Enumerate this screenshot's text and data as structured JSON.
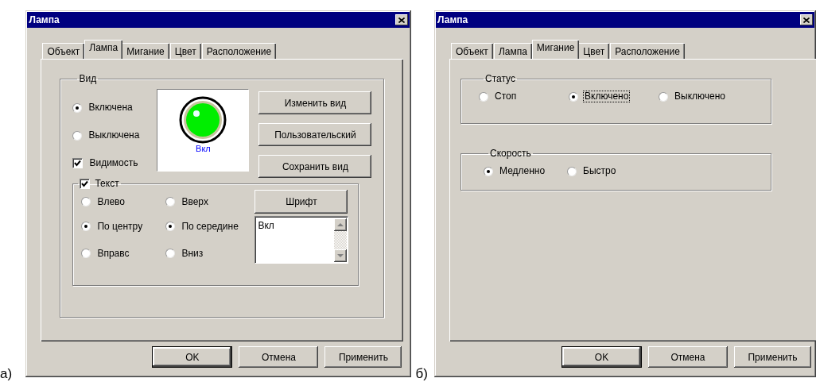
{
  "panels": [
    {
      "caption": "а)",
      "kind": "lamp",
      "window": {
        "title": "Лампа",
        "tabs": [
          {
            "label": "Объект",
            "selected": false
          },
          {
            "label": "Лампа",
            "selected": true
          },
          {
            "label": "Мигание",
            "selected": false
          },
          {
            "label": "Цвет",
            "selected": false
          },
          {
            "label": "Расположение",
            "selected": false
          }
        ],
        "view_group": {
          "label": "Вид",
          "radios": [
            {
              "label": "Включена",
              "selected": true
            },
            {
              "label": "Выключена",
              "selected": false
            }
          ],
          "visibility": {
            "label": "Видимость",
            "checked": true
          },
          "preview_text": "Вкл",
          "buttons": [
            "Изменить вид",
            "Пользовательский",
            "Сохранить вид"
          ]
        },
        "text_group": {
          "label": "Текст",
          "checked": true,
          "horizontal": [
            {
              "label": "Влево",
              "selected": false
            },
            {
              "label": "По центру",
              "selected": true
            },
            {
              "label": "Вправс",
              "selected": false
            }
          ],
          "vertical": [
            {
              "label": "Вверх",
              "selected": false
            },
            {
              "label": "По середине",
              "selected": true
            },
            {
              "label": "Вниз",
              "selected": false
            }
          ],
          "font_button": "Шрифт",
          "text_value": "Вкл"
        },
        "buttons": [
          {
            "label": "OK",
            "default": true
          },
          {
            "label": "Отмена",
            "default": false
          },
          {
            "label": "Применить",
            "default": false
          }
        ]
      }
    },
    {
      "caption": "б)",
      "kind": "blink",
      "window": {
        "title": "Лампа",
        "tabs": [
          {
            "label": "Объект",
            "selected": false
          },
          {
            "label": "Лампа",
            "selected": false
          },
          {
            "label": "Мигание",
            "selected": true
          },
          {
            "label": "Цвет",
            "selected": false
          },
          {
            "label": "Расположение",
            "selected": false
          }
        ],
        "groups": [
          {
            "label": "Статус",
            "options": [
              {
                "label": "Стоп",
                "selected": false,
                "focused": false
              },
              {
                "label": "Включено",
                "selected": true,
                "focused": true
              },
              {
                "label": "Выключено",
                "selected": false,
                "focused": false
              }
            ]
          },
          {
            "label": "Скорость",
            "options": [
              {
                "label": "Медленно",
                "selected": true,
                "focused": false
              },
              {
                "label": "Быстро",
                "selected": false,
                "focused": false
              }
            ]
          }
        ],
        "buttons": [
          {
            "label": "OK",
            "default": true
          },
          {
            "label": "Отмена",
            "default": false
          },
          {
            "label": "Применить",
            "default": false
          }
        ]
      }
    }
  ]
}
